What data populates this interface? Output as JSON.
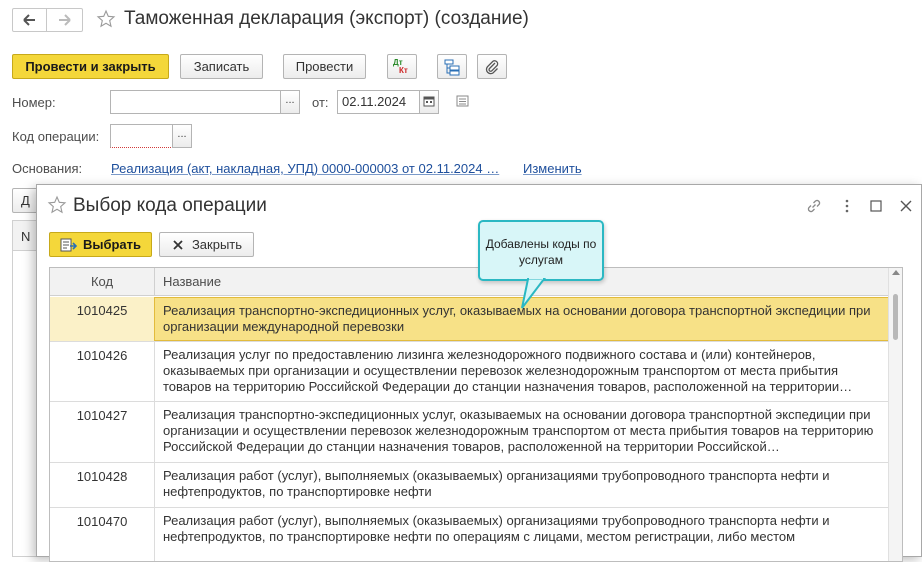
{
  "window": {
    "title": "Таможенная декларация (экспорт) (создание)"
  },
  "toolbar": {
    "post_close_label": "Провести и закрыть",
    "save_label": "Записать",
    "post_label": "Провести",
    "dt_kt_top": "Дт",
    "dt_kt_bottom": "Кт"
  },
  "form": {
    "number_label": "Номер:",
    "number_value": "",
    "from_label": "от:",
    "date_value": "02.11.2024",
    "op_code_label": "Код операции:",
    "op_code_value": "",
    "basis_label": "Основания:",
    "basis_link": "Реализация (акт, накладная, УПД) 0000-000003 от 02.11.2024 …",
    "change_link": "Изменить",
    "bg_button_partial": "Д",
    "bg_col_partial": "N"
  },
  "dialog": {
    "title": "Выбор кода операции",
    "select_label": "Выбрать",
    "close_label": "Закрыть",
    "columns": {
      "code": "Код",
      "name": "Название"
    },
    "rows": [
      {
        "code": "1010425",
        "name": "Реализация транспортно-экспедиционных услуг, оказываемых на основании договора транспортной экспедиции при организации международной перевозки"
      },
      {
        "code": "1010426",
        "name": "Реализация услуг по предоставлению лизинга железнодорожного подвижного состава и (или) контейнеров, оказываемых при организации и осуществлении перевозок железнодорожным транспортом от места прибытия товаров на территорию Российской Федерации до станции назначения товаров, расположенной на территории…"
      },
      {
        "code": "1010427",
        "name": "Реализация транспортно-экспедиционных услуг, оказываемых на основании договора транспортной экспедиции при организации и осуществлении перевозок железнодорожным транспортом от места прибытия товаров на территорию Российской Федерации до станции назначения товаров, расположенной на территории Российской…"
      },
      {
        "code": "1010428",
        "name": "Реализация работ (услуг), выполняемых (оказываемых) организациями трубопроводного транспорта нефти и нефтепродуктов, по транспортировке нефти"
      },
      {
        "code": "1010470",
        "name": "Реализация работ (услуг), выполняемых (оказываемых) организациями трубопроводного транспорта нефти и нефтепродуктов, по транспортировке нефти по операциям с лицами, местом регистрации, либо местом"
      }
    ],
    "callout": "Добавлены коды по услугам"
  },
  "colors": {
    "accent_yellow": "#f4d73a",
    "link_blue": "#1e4f9c",
    "selection": "#f7e187",
    "callout_border": "#2bb8c3",
    "callout_fill": "#d8f6f8"
  },
  "icons": [
    "back-arrow-icon",
    "forward-arrow-icon",
    "star-icon",
    "calendar-icon",
    "dt-kt-icon",
    "structure-icon",
    "paperclip-icon",
    "document-list-icon",
    "select-icon",
    "close-x-icon",
    "link-icon",
    "more-icon",
    "maximize-icon",
    "close-icon"
  ]
}
